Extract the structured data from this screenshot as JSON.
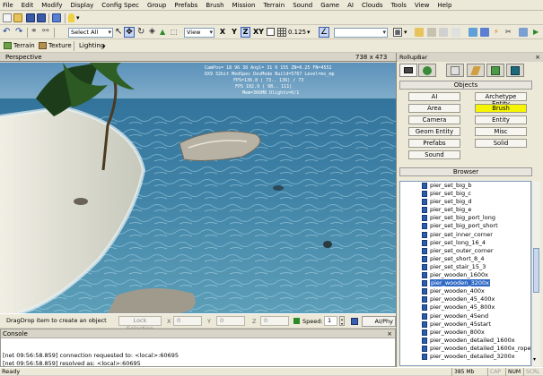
{
  "menu": [
    "File",
    "Edit",
    "Modify",
    "Display",
    "Config Spec",
    "Group",
    "Prefabs",
    "Brush",
    "Mission",
    "Terrain",
    "Sound",
    "Game",
    "AI",
    "Clouds",
    "Tools",
    "View",
    "Help"
  ],
  "toolbar2": {
    "selection": "Select All",
    "view": "View",
    "axes": [
      "X",
      "Y",
      "Z",
      "XY"
    ],
    "grid_value": "0.125"
  },
  "toolbar3": {
    "terrain": "Terrain",
    "texture": "Texture",
    "lighting": "Lighting"
  },
  "viewport": {
    "name": "Perspective",
    "resolution": "738 x 473"
  },
  "statusrow": {
    "hint": "DragDrop item to create an object",
    "lock": "Lock Selection",
    "x_label": "X",
    "x_val": "0",
    "y_label": "Y",
    "y_val": "0",
    "z_label": "Z",
    "z_val": "0",
    "speed_label": "Speed:",
    "speed_val": "1",
    "ai": "AI/Phy"
  },
  "console": {
    "title": "Console",
    "lines": [
      "[net 09:56:58.859] connection requested to: <local>:60695",
      "[net 09:56:58.859] resolved as: <local>:60695"
    ]
  },
  "statusbar": {
    "ready": "Ready",
    "memory": "385 Mb",
    "cap": "CAP",
    "num": "NUM",
    "scrl": "SCRL"
  },
  "rollup": {
    "title": "RollupBar",
    "objects_label": "Objects",
    "buttons": [
      "AI",
      "Archetype Entity",
      "Area",
      "Brush",
      "Camera",
      "Entity",
      "Geom Entity",
      "Misc",
      "Prefabs",
      "Solid",
      "Sound"
    ],
    "selected_button": "Brush",
    "browser_label": "Browser",
    "items": [
      "pier_set_big_b",
      "pier_set_big_c",
      "pier_set_big_d",
      "pier_set_big_e",
      "pier_set_big_port_long",
      "pier_set_big_port_short",
      "pier_set_inner_corner",
      "pier_set_long_16_4",
      "pier_set_outer_corner",
      "pier_set_short_8_4",
      "pier_set_stair_15_3",
      "pier_wooden_1600x",
      "pier_wooden_3200x",
      "pier_wooden_400x",
      "pier_wooden_45_400x",
      "pier_wooden_45_800x",
      "pier_wooden_45end",
      "pier_wooden_45start",
      "pier_wooden_800x",
      "pier_wooden_detailed_1600x",
      "pier_wooden_detailed_1600x_rope",
      "pier_wooden_detailed_3200x"
    ],
    "selected_item": "pier_wooden_3200x"
  }
}
